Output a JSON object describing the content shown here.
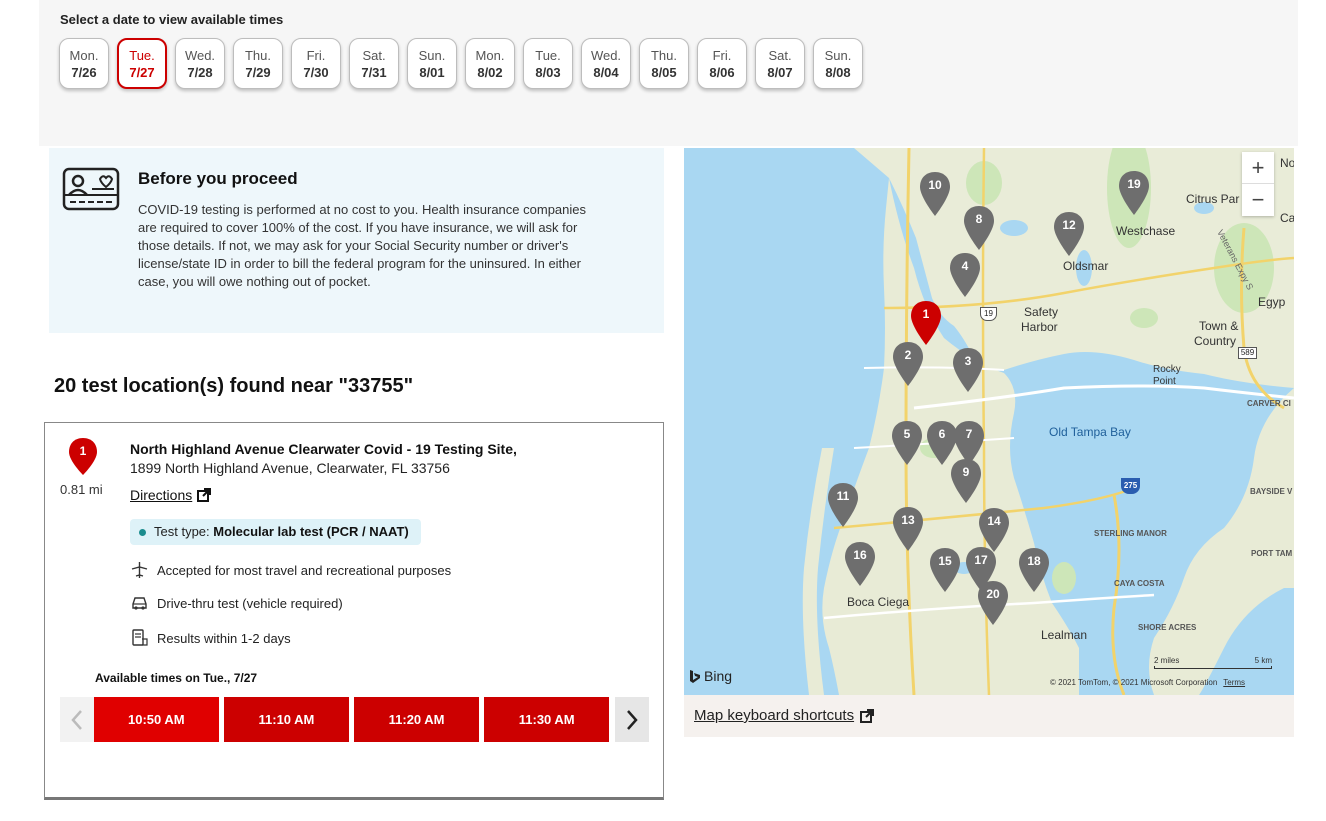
{
  "dates": {
    "label": "Select a date to view available times",
    "items": [
      {
        "day": "Mon.",
        "date": "7/26"
      },
      {
        "day": "Tue.",
        "date": "7/27",
        "selected": true
      },
      {
        "day": "Wed.",
        "date": "7/28"
      },
      {
        "day": "Thu.",
        "date": "7/29"
      },
      {
        "day": "Fri.",
        "date": "7/30"
      },
      {
        "day": "Sat.",
        "date": "7/31"
      },
      {
        "day": "Sun.",
        "date": "8/01"
      },
      {
        "day": "Mon.",
        "date": "8/02"
      },
      {
        "day": "Tue.",
        "date": "8/03"
      },
      {
        "day": "Wed.",
        "date": "8/04"
      },
      {
        "day": "Thu.",
        "date": "8/05"
      },
      {
        "day": "Fri.",
        "date": "8/06"
      },
      {
        "day": "Sat.",
        "date": "8/07"
      },
      {
        "day": "Sun.",
        "date": "8/08"
      }
    ]
  },
  "notice": {
    "title": "Before you proceed",
    "body": "COVID-19 testing is performed at no cost to you. Health insurance companies are required to cover 100% of the cost. If you have insurance, we will ask for those details. If not, we may ask for your Social Security number or driver's license/state ID in order to bill the federal program for the uninsured. In either case, you will owe nothing out of pocket."
  },
  "results": {
    "heading": "20 test location(s) found near \"33755\""
  },
  "location": {
    "number": "1",
    "distance": "0.81 mi",
    "name": "North Highland Avenue Clearwater Covid - 19 Testing Site,",
    "address": "1899 North Highland Avenue, Clearwater, FL 33756",
    "directions_label": "Directions",
    "test_type_label": "Test type: ",
    "test_type_value": "Molecular lab test (PCR / NAAT)",
    "features": [
      {
        "icon": "airplane-icon",
        "text": "Accepted for most travel and recreational purposes"
      },
      {
        "icon": "car-icon",
        "text": "Drive-thru test (vehicle required)"
      },
      {
        "icon": "phone-results-icon",
        "text": "Results within 1-2 days"
      }
    ],
    "available_label": "Available times on Tue., 7/27",
    "times": [
      "10:50 AM",
      "11:10 AM",
      "11:20 AM",
      "11:30 AM"
    ]
  },
  "map": {
    "labels": {
      "citrus_park": "Citrus Par",
      "westchase": "Westchase",
      "oldsmar": "Oldsmar",
      "safety": "Safety",
      "harbor": "Harbor",
      "town": "Town &",
      "country": "Country",
      "rocky": "Rocky",
      "point": "Point",
      "old_tampa_bay": "Old Tampa Bay",
      "carver": "CARVER CI",
      "bayside": "BAYSIDE V",
      "sterling": "STERLING MANOR",
      "port_tampa": "PORT TAM",
      "caya_costa": "CAYA COSTA",
      "shore_acres": "SHORE ACRES",
      "boca_ciega": "Boca Ciega",
      "lealman": "Lealman",
      "egypt": "Egyp",
      "nor": "Nor",
      "ca": "Ca",
      "veterans": "Veterans Expy S",
      "hwy19": "19",
      "hwy589": "589",
      "hwy275": "275"
    },
    "pins": [
      "1",
      "2",
      "3",
      "4",
      "5",
      "6",
      "7",
      "8",
      "9",
      "10",
      "11",
      "12",
      "13",
      "14",
      "15",
      "16",
      "17",
      "18",
      "19",
      "20"
    ],
    "zoom_in": "+",
    "zoom_out": "−",
    "bing": "Bing",
    "scale_miles": "2 miles",
    "scale_km": "5 km",
    "copyright": "© 2021 TomTom, © 2021 Microsoft Corporation",
    "terms": "Terms"
  },
  "map_footer": {
    "shortcuts_label": "Map keyboard shortcuts"
  }
}
